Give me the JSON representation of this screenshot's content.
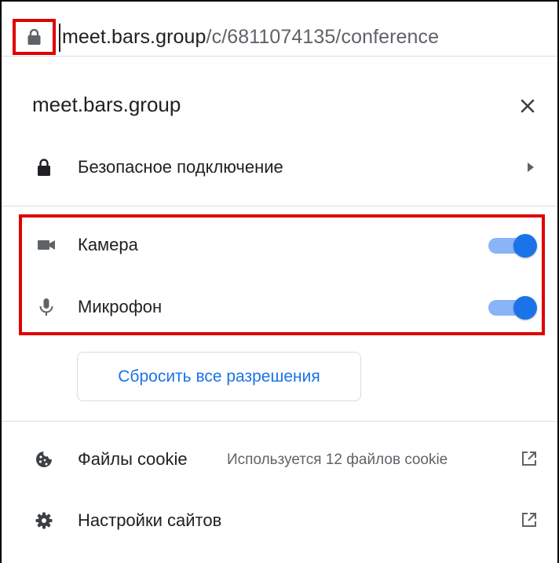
{
  "address_bar": {
    "url_host": "meet.bars.group",
    "url_path": "/c/6811074135/conference"
  },
  "popup": {
    "title": "meet.bars.group",
    "connection": {
      "label": "Безопасное подключение",
      "icon": "lock-icon"
    },
    "permissions": [
      {
        "label": "Камера",
        "icon": "camera-icon",
        "enabled": true
      },
      {
        "label": "Микрофон",
        "icon": "microphone-icon",
        "enabled": true
      }
    ],
    "reset_label": "Сбросить все разрешения",
    "cookies": {
      "label": "Файлы cookie",
      "detail": "Используется 12 файлов cookie",
      "icon": "cookie-icon"
    },
    "site_settings": {
      "label": "Настройки сайтов",
      "icon": "gear-icon"
    }
  },
  "colors": {
    "accent": "#1a73e8",
    "toggle_track": "#8ab4f8",
    "highlight": "#e00000",
    "icon": "#5f6368"
  }
}
